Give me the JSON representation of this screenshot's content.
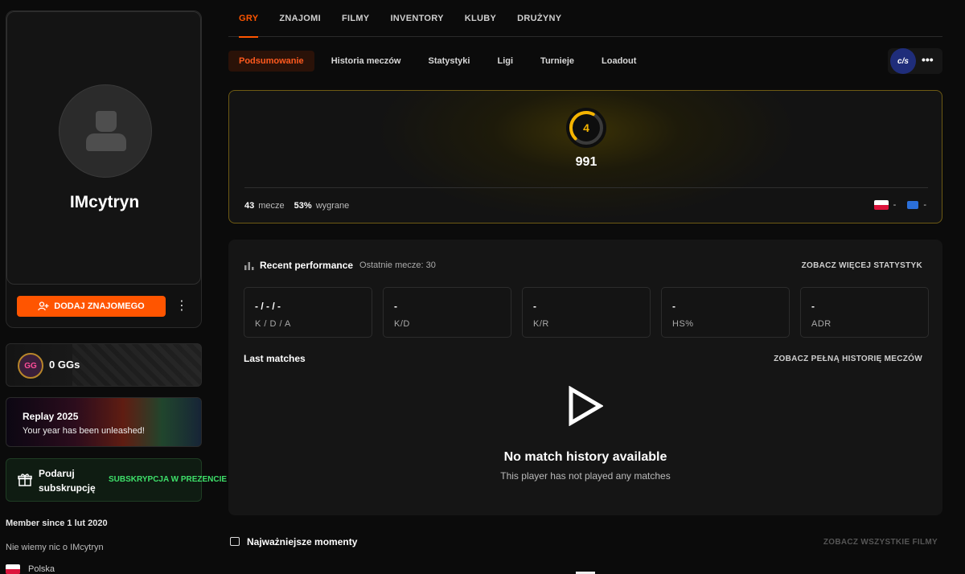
{
  "profile": {
    "username": "IMcytryn",
    "add_friend_label": "DODAJ ZNAJOMEGO",
    "more_glyph": "⋮"
  },
  "sidebar": {
    "ggs": {
      "badge": "GG",
      "label": "0 GGs"
    },
    "replay": {
      "title": "Replay 2025",
      "subtitle": "Your year has been unleashed!"
    },
    "gift": {
      "label": "Podaruj subskrupcję",
      "promo": "SUBSKRYPCJA W PREZENCIE"
    },
    "member_since": "Member since 1 lut 2020",
    "about": "Nie wiemy nic o IMcytryn",
    "country": "Polska"
  },
  "top_tabs": [
    {
      "label": "GRY",
      "active": true
    },
    {
      "label": "ZNAJOMI",
      "active": false
    },
    {
      "label": "FILMY",
      "active": false
    },
    {
      "label": "INVENTORY",
      "active": false
    },
    {
      "label": "KLUBY",
      "active": false
    },
    {
      "label": "DRUŻYNY",
      "active": false
    }
  ],
  "sub_tabs": [
    {
      "label": "Podsumowanie",
      "active": true
    },
    {
      "label": "Historia meczów",
      "active": false
    },
    {
      "label": "Statystyki",
      "active": false
    },
    {
      "label": "Ligi",
      "active": false
    },
    {
      "label": "Turnieje",
      "active": false
    },
    {
      "label": "Loadout",
      "active": false
    }
  ],
  "game_switch": {
    "logo_text": "c/s",
    "more_glyph": "•••"
  },
  "elo": {
    "level": "4",
    "level_progress": 0.6,
    "value": "991",
    "matches_count": "43",
    "matches_label": "mecze",
    "winrate": "53%",
    "winrate_label": "wygrane",
    "country_rank": "-",
    "region_rank": "-",
    "accent_color": "#f5b400"
  },
  "performance": {
    "title": "Recent performance",
    "subtitle": "Ostatnie mecze: 30",
    "link": "ZOBACZ WIĘCEJ STATYSTYK",
    "stats": [
      {
        "value": "- / - / -",
        "label": "K / D / A"
      },
      {
        "value": "-",
        "label": "K/D"
      },
      {
        "value": "-",
        "label": "K/R"
      },
      {
        "value": "-",
        "label": "HS%"
      },
      {
        "value": "-",
        "label": "ADR"
      }
    ],
    "last_matches_title": "Last matches",
    "last_matches_link": "ZOBACZ PEŁNĄ HISTORIĘ MECZÓW",
    "empty_title": "No match history available",
    "empty_subtitle": "This player has not played any matches"
  },
  "moments": {
    "title": "Najważniejsze momenty",
    "link": "ZOBACZ WSZYSTKIE FILMY"
  },
  "colors": {
    "brand": "#ff5500",
    "green": "#3ee06a",
    "gold_border": "#6e5a14"
  }
}
